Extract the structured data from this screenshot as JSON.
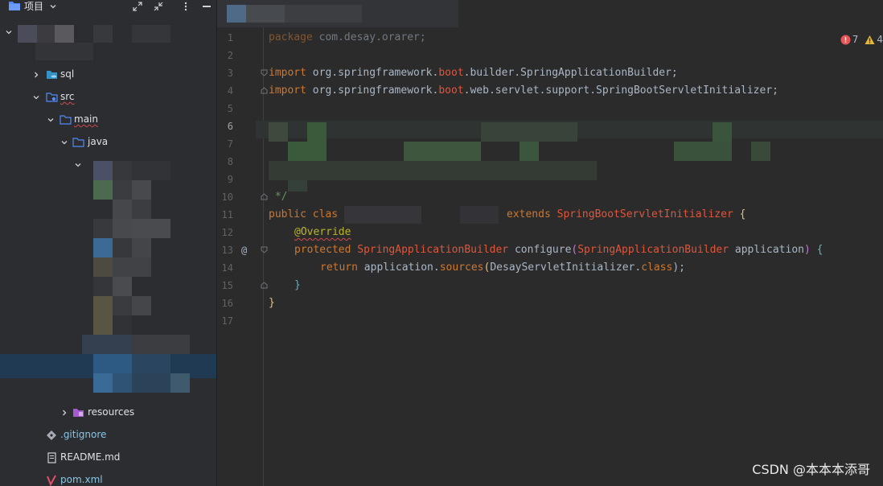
{
  "project_panel": {
    "title": "项目",
    "tree": [
      {
        "label": "sql",
        "type": "folder-sql",
        "expanded": false
      },
      {
        "label": "src",
        "type": "folder-src",
        "expanded": true
      },
      {
        "label": "main",
        "type": "folder",
        "expanded": true
      },
      {
        "label": "java",
        "type": "folder-source",
        "expanded": true
      },
      {
        "label": "resources",
        "type": "folder-resources",
        "expanded": false
      },
      {
        "label": ".gitignore",
        "type": "file-gitignore"
      },
      {
        "label": "README.md",
        "type": "file-markdown"
      },
      {
        "label": "pom.xml",
        "type": "file-maven"
      }
    ]
  },
  "editor": {
    "line_numbers": [
      "1",
      "2",
      "3",
      "4",
      "5",
      "6",
      "7",
      "8",
      "9",
      "10",
      "11",
      "12",
      "13",
      "14",
      "15",
      "16",
      "17"
    ],
    "current_line": "6",
    "code": {
      "l1": {
        "kw": "package",
        "rest": " com.desay.orarer;"
      },
      "l3": {
        "kw": "import",
        "a": " org.springframework.",
        "b": "boot",
        "c": ".builder.SpringApplicationBuilder;"
      },
      "l4": {
        "kw": "import",
        "a": " org.springframework.",
        "b": "boot",
        "c": ".web.servlet.support.SpringBootServletInitializer;"
      },
      "l10": " */",
      "l11": {
        "kw1": "public",
        "kw2": "clas",
        "kw3": "extends",
        "cls": "SpringBootServletInitializer",
        "brace": "{"
      },
      "l12": "@Override",
      "l13": {
        "kw": "protected",
        "type": "SpringApplicationBuilder",
        "method": "configure",
        "param_type": "SpringApplicationBuilder",
        "param": "application",
        "brace": "{"
      },
      "l14": {
        "kw": "return",
        "a": " application.",
        "b": "sources",
        "c": "DesayServletInitializer.",
        "d": "class",
        "e": ");"
      },
      "l15": "}",
      "l16": "}"
    },
    "gutter_override_mark": "@",
    "inspections": {
      "errors": "7",
      "warnings": "4"
    }
  },
  "watermark": "CSDN @本本本添哥",
  "colors": {
    "keyword": "#cc7832",
    "class": "#e1553a",
    "annotation": "#bbb529",
    "comment": "#629755",
    "text": "#a9b7c6",
    "error": "#e55757",
    "warning": "#e5b93a"
  }
}
